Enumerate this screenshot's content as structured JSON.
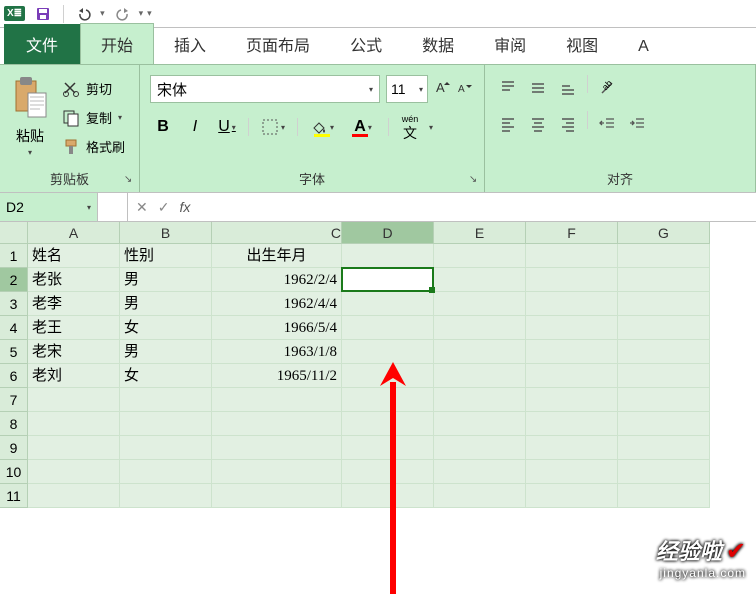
{
  "qat": {
    "xl_label": "X≣",
    "undo_drop": "▾",
    "redo_drop": "▾",
    "more_drop": "▾"
  },
  "tabs": {
    "file": "文件",
    "items": [
      "开始",
      "插入",
      "页面布局",
      "公式",
      "数据",
      "审阅",
      "视图",
      "A"
    ],
    "active_index": 0
  },
  "ribbon": {
    "clipboard": {
      "paste": "粘贴",
      "cut": "剪切",
      "copy": "复制",
      "format_painter": "格式刷",
      "group_label": "剪贴板",
      "copy_drop": "▾",
      "paste_drop": "▾"
    },
    "font": {
      "name": "宋体",
      "size": "11",
      "group_label": "字体",
      "bold": "B",
      "italic": "I",
      "underline": "U",
      "wen": "wén",
      "drop": "▾",
      "launcher": "↘"
    },
    "align": {
      "group_label": "对齐"
    }
  },
  "fbar": {
    "namebox": "D2",
    "drop": "▾",
    "cancel": "✕",
    "enter": "✓",
    "fx": "fx",
    "formula": ""
  },
  "grid": {
    "cols": [
      "A",
      "B",
      "C",
      "D",
      "E",
      "F",
      "G"
    ],
    "rows": [
      {
        "n": "1",
        "A": "姓名",
        "B": "性别",
        "C": "出生年月",
        "Chdr": true
      },
      {
        "n": "2",
        "A": "老张",
        "B": "男",
        "C": "1962/2/4"
      },
      {
        "n": "3",
        "A": "老李",
        "B": "男",
        "C": "1962/4/4"
      },
      {
        "n": "4",
        "A": "老王",
        "B": "女",
        "C": "1966/5/4"
      },
      {
        "n": "5",
        "A": "老宋",
        "B": "男",
        "C": "1963/1/8"
      },
      {
        "n": "6",
        "A": "老刘",
        "B": "女",
        "C": "1965/11/2"
      },
      {
        "n": "7"
      },
      {
        "n": "8"
      },
      {
        "n": "9"
      },
      {
        "n": "10"
      },
      {
        "n": "11"
      }
    ],
    "selected_col": "D",
    "selected_row": "2"
  },
  "watermark": {
    "main": "经验啦",
    "check": "✔",
    "sub": "jingyanla.com"
  }
}
